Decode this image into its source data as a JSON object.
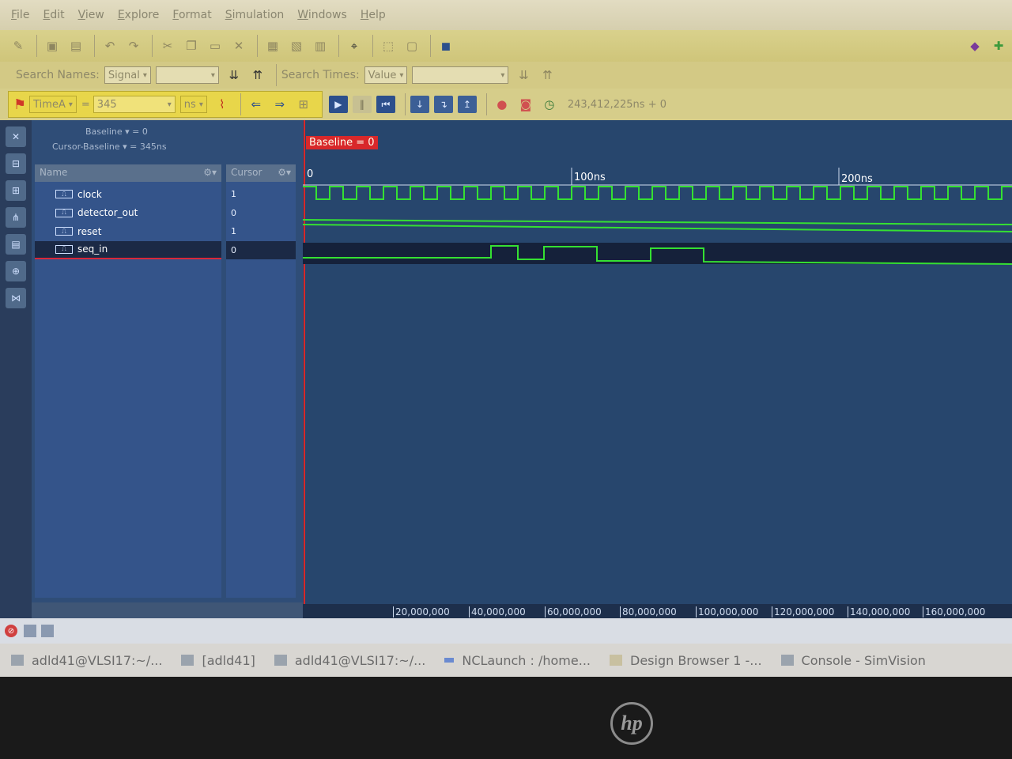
{
  "menubar": {
    "items": [
      "File",
      "Edit",
      "View",
      "Explore",
      "Format",
      "Simulation",
      "Windows",
      "Help"
    ]
  },
  "search": {
    "names_label": "Search Names:",
    "names_mode": "Signal",
    "times_label": "Search Times:",
    "times_mode": "Value"
  },
  "time_controls": {
    "marker": "TimeA",
    "equals": "=",
    "value": "345",
    "unit": "ns",
    "sim_time": "243,412,225ns + 0"
  },
  "baseline_info": {
    "baseline": "Baseline ▾ = 0",
    "cursor_baseline": "Cursor-Baseline ▾ = 345ns"
  },
  "names_panel": {
    "header": "Name",
    "signals": [
      {
        "name": "clock"
      },
      {
        "name": "detector_out"
      },
      {
        "name": "reset"
      },
      {
        "name": "seq_in"
      }
    ]
  },
  "cursor_panel": {
    "header": "Cursor",
    "values": [
      "1",
      "0",
      "1",
      "0"
    ]
  },
  "waveform": {
    "baseline_badge": "Baseline = 0",
    "ruler": [
      "0",
      "100ns",
      "200ns"
    ],
    "bottom_scale": [
      "20,000,000",
      "40,000,000",
      "60,000,000",
      "80,000,000",
      "100,000,000",
      "120,000,000",
      "140,000,000",
      "160,000,000"
    ]
  },
  "taskbar": {
    "items": [
      "adld41@VLSI17:~/...",
      "[adld41]",
      "adld41@VLSI17:~/...",
      "NCLaunch : /home...",
      "Design Browser 1 -...",
      "Console - SimVision"
    ]
  },
  "colors": {
    "wave": "#35e032",
    "window_bg": "#27466d",
    "toolbar": "#d6cd8a",
    "accent_red": "#d8282a"
  }
}
